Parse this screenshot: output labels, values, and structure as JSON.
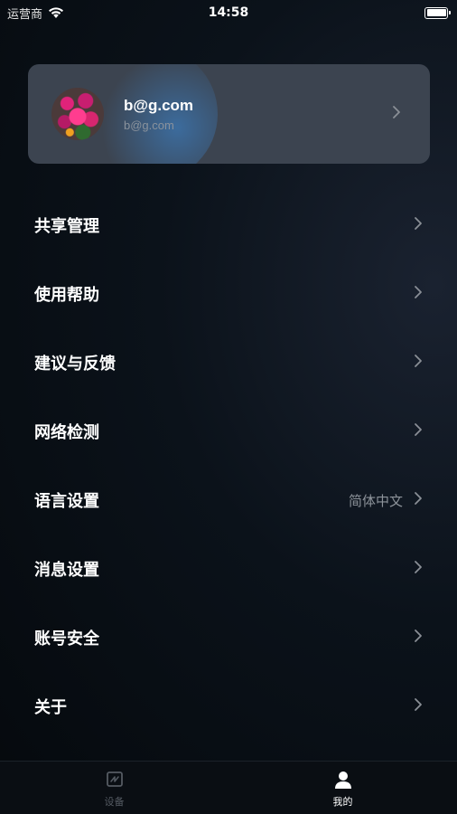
{
  "status_bar": {
    "carrier": "运营商",
    "time": "14:58",
    "battery_level": 1.0
  },
  "profile": {
    "name": "b@g.com",
    "email": "b@g.com",
    "avatar_icon": "flower-avatar",
    "chevron_icon": "chevron-right-icon"
  },
  "menu": {
    "items": [
      {
        "label": "共享管理",
        "value": ""
      },
      {
        "label": "使用帮助",
        "value": ""
      },
      {
        "label": "建议与反馈",
        "value": ""
      },
      {
        "label": "网络检测",
        "value": ""
      },
      {
        "label": "语言设置",
        "value": "简体中文"
      },
      {
        "label": "消息设置",
        "value": ""
      },
      {
        "label": "账号安全",
        "value": ""
      },
      {
        "label": "关于",
        "value": ""
      }
    ]
  },
  "tab_bar": {
    "tabs": [
      {
        "label": "设备",
        "icon": "device-icon",
        "active": false
      },
      {
        "label": "我的",
        "icon": "person-icon",
        "active": true
      }
    ]
  },
  "colors": {
    "background": "#05090d",
    "card": "#3c4450",
    "accent_glow": "#3c8cdc",
    "secondary_text": "#8d939a"
  }
}
